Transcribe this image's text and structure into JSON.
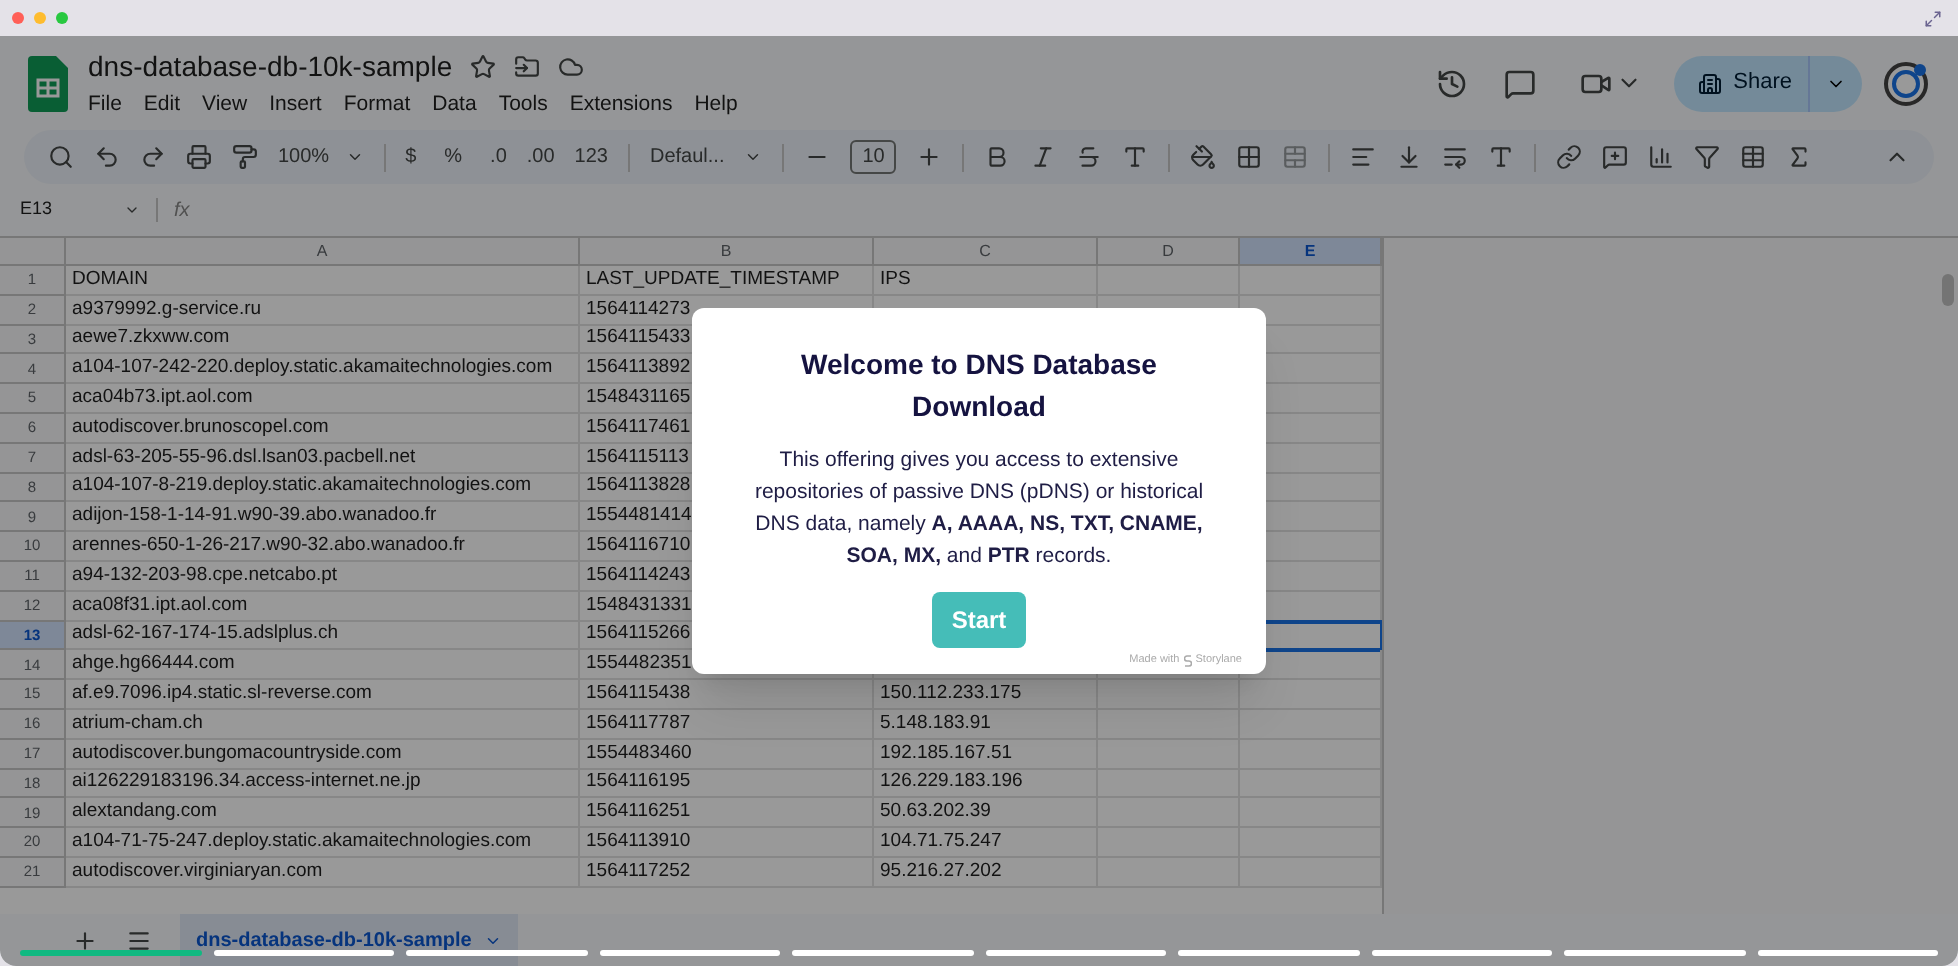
{
  "document": {
    "title": "dns-database-db-10k-sample"
  },
  "menu": [
    "File",
    "Edit",
    "View",
    "Insert",
    "Format",
    "Data",
    "Tools",
    "Extensions",
    "Help"
  ],
  "share": {
    "label": "Share"
  },
  "toolbar": {
    "zoom": "100%",
    "currency": "$",
    "percent": "%",
    "decrease_decimal": ".0",
    "increase_decimal": ".00",
    "number_format": "123",
    "font": "Defaul...",
    "font_size": "10"
  },
  "formula_bar": {
    "cell": "E13",
    "fx": "fx"
  },
  "columns": [
    {
      "label": "A",
      "selected": false
    },
    {
      "label": "B",
      "selected": false
    },
    {
      "label": "C",
      "selected": false
    },
    {
      "label": "D",
      "selected": false
    },
    {
      "label": "E",
      "selected": true
    }
  ],
  "rows": [
    {
      "number": "1",
      "selected": false,
      "cells": [
        "DOMAIN",
        "LAST_UPDATE_TIMESTAMP",
        "IPS"
      ]
    },
    {
      "number": "2",
      "selected": false,
      "cells": [
        "a9379992.g-service.ru",
        "1564114273"
      ]
    },
    {
      "number": "3",
      "selected": false,
      "cells": [
        "aewe7.zkxww.com",
        "1564115433"
      ]
    },
    {
      "number": "4",
      "selected": false,
      "cells": [
        "a104-107-242-220.deploy.static.akamaitechnologies.com",
        "1564113892"
      ]
    },
    {
      "number": "5",
      "selected": false,
      "cells": [
        "aca04b73.ipt.aol.com",
        "1548431165"
      ]
    },
    {
      "number": "6",
      "selected": false,
      "cells": [
        "autodiscover.brunoscopel.com",
        "1564117461"
      ]
    },
    {
      "number": "7",
      "selected": false,
      "cells": [
        "adsl-63-205-55-96.dsl.lsan03.pacbell.net",
        "1564115113"
      ]
    },
    {
      "number": "8",
      "selected": false,
      "cells": [
        "a104-107-8-219.deploy.static.akamaitechnologies.com",
        "1564113828"
      ]
    },
    {
      "number": "9",
      "selected": false,
      "cells": [
        "adijon-158-1-14-91.w90-39.abo.wanadoo.fr",
        "1554481414"
      ]
    },
    {
      "number": "10",
      "selected": false,
      "cells": [
        "arennes-650-1-26-217.w90-32.abo.wanadoo.fr",
        "1564116710"
      ]
    },
    {
      "number": "11",
      "selected": false,
      "cells": [
        "a94-132-203-98.cpe.netcabo.pt",
        "1564114243"
      ]
    },
    {
      "number": "12",
      "selected": false,
      "cells": [
        "aca08f31.ipt.aol.com",
        "1548431331"
      ]
    },
    {
      "number": "13",
      "selected": true,
      "cells": [
        "adsl-62-167-174-15.adslplus.ch",
        "1564115266"
      ]
    },
    {
      "number": "14",
      "selected": false,
      "cells": [
        "ahge.hg66444.com",
        "1554482351"
      ]
    },
    {
      "number": "15",
      "selected": false,
      "cells": [
        "af.e9.7096.ip4.static.sl-reverse.com",
        "1564115438",
        "150.112.233.175"
      ]
    },
    {
      "number": "16",
      "selected": false,
      "cells": [
        "atrium-cham.ch",
        "1564117787",
        "5.148.183.91"
      ]
    },
    {
      "number": "17",
      "selected": false,
      "cells": [
        "autodiscover.bungomacountryside.com",
        "1554483460",
        "192.185.167.51"
      ]
    },
    {
      "number": "18",
      "selected": false,
      "cells": [
        "ai126229183196.34.access-internet.ne.jp",
        "1564116195",
        "126.229.183.196"
      ]
    },
    {
      "number": "19",
      "selected": false,
      "cells": [
        "alextandang.com",
        "1564116251",
        "50.63.202.39"
      ]
    },
    {
      "number": "20",
      "selected": false,
      "cells": [
        "a104-71-75-247.deploy.static.akamaitechnologies.com",
        "1564113910",
        "104.71.75.247"
      ]
    },
    {
      "number": "21",
      "selected": false,
      "cells": [
        "autodiscover.virginiaryan.com",
        "1564117252",
        "95.216.27.202"
      ]
    }
  ],
  "sheet_tabs": [
    {
      "label": "dns-database-db-10k-sample",
      "selected": true
    }
  ],
  "modal": {
    "title": "Welcome to DNS Database Download",
    "body": "This offering gives you access to extensive repositories of passive DNS (pDNS) or historical DNS data, namely **A, AAAA, NS, TXT, CNAME, SOA, MX,** and **PTR** records.",
    "button": "Start",
    "credit": "Made with",
    "brand": "Storylane"
  },
  "tour_steps": [
    {
      "done": true
    },
    {
      "done": false
    },
    {
      "done": false
    },
    {
      "done": false
    },
    {
      "done": false
    },
    {
      "done": false
    },
    {
      "done": false
    },
    {
      "done": false
    },
    {
      "done": false
    },
    {
      "done": false
    }
  ]
}
